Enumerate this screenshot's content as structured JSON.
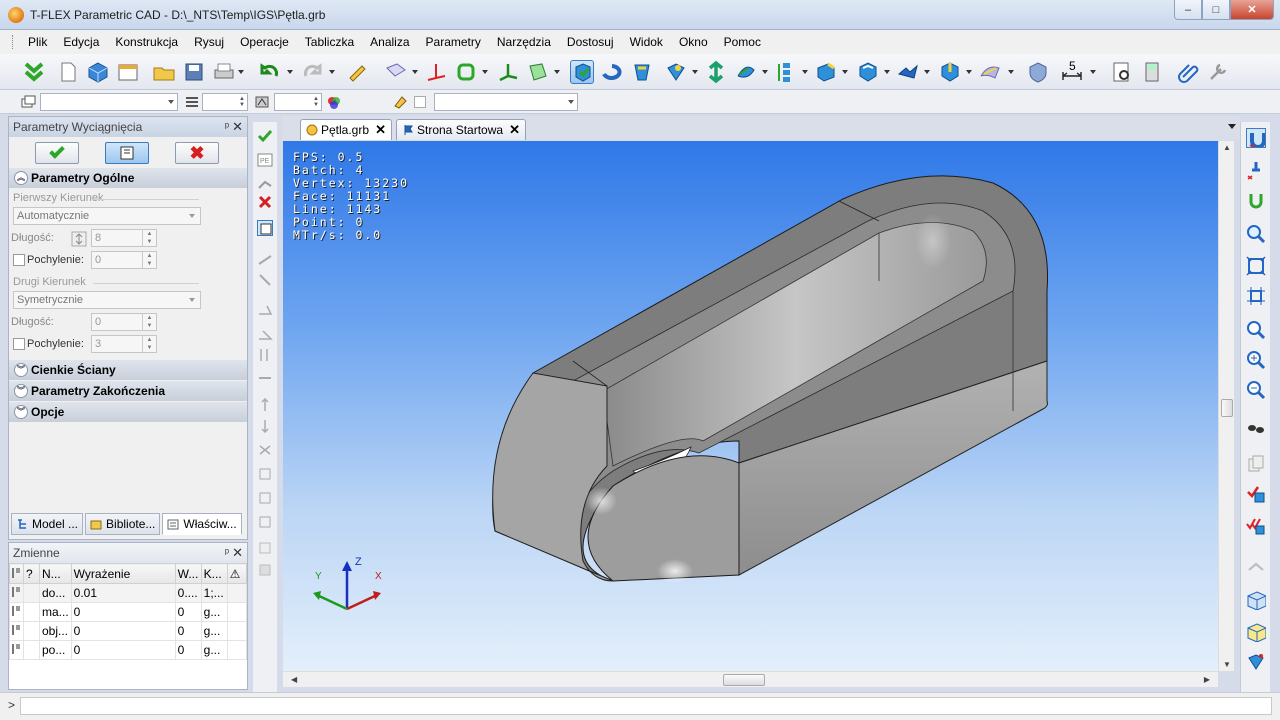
{
  "window": {
    "title": "T-FLEX Parametric CAD - D:\\_NTS\\Temp\\IGS\\Pętla.grb",
    "minimize": "–",
    "maximize": "□",
    "close": "✕"
  },
  "menu": [
    "Plik",
    "Edycja",
    "Konstrukcja",
    "Rysuj",
    "Operacje",
    "Tabliczka",
    "Analiza",
    "Parametry",
    "Narzędzia",
    "Dostosuj",
    "Widok",
    "Okno",
    "Pomoc"
  ],
  "dimension_tool_label": "5",
  "left_panel": {
    "title": "Parametry Wyciągnięcia",
    "pin": "ᵖ",
    "close": "✕",
    "section_general": "Parametry Ogólne",
    "first_direction_label": "Pierwszy Kierunek",
    "first_direction_value": "Automatycznie",
    "length_label": "Długość:",
    "length_value": "8",
    "slope_label": "Pochylenie:",
    "slope_value": "0",
    "second_direction_label": "Drugi Kierunek",
    "second_direction_value": "Symetrycznie",
    "length2_label": "Długość:",
    "length2_value": "0",
    "slope2_label": "Pochylenie:",
    "slope2_value": "3",
    "section_thin_walls": "Cienkie Ściany",
    "section_end_params": "Parametry Zakończenia",
    "section_options": "Opcje",
    "tabs": [
      "Model ...",
      "Bibliote...",
      "Właściw..."
    ]
  },
  "variables_panel": {
    "title": "Zmienne",
    "columns": [
      "?",
      "N...",
      "Wyrażenie",
      "W...",
      "K..."
    ],
    "rows": [
      {
        "name": "do...",
        "expr": "0.01",
        "w": "0....",
        "k": "1;..."
      },
      {
        "name": "ma...",
        "expr": "0",
        "w": "0",
        "k": "g..."
      },
      {
        "name": "obj...",
        "expr": "0",
        "w": "0",
        "k": "g..."
      },
      {
        "name": "po...",
        "expr": "0",
        "w": "0",
        "k": "g..."
      }
    ]
  },
  "document_tabs": [
    {
      "label": "Pętla.grb",
      "active": true
    },
    {
      "label": "Strona Startowa",
      "active": false
    }
  ],
  "viewport_stats": [
    "FPS: 0.5",
    "Batch: 4",
    "Vertex: 13230",
    "Face: 11131",
    "Line: 1143",
    "Point: 0",
    "MTr/s: 0.0"
  ],
  "axes": {
    "x": "X",
    "y": "Y",
    "z": "Z"
  },
  "status_prompt": ">",
  "colors": {
    "accent": "#3b7bbf",
    "ok": "#2ea62a",
    "cancel": "#d62020",
    "viewport_top": "#2f78e8",
    "viewport_bottom": "#e4effb",
    "model_face": "#9a9a9a"
  }
}
